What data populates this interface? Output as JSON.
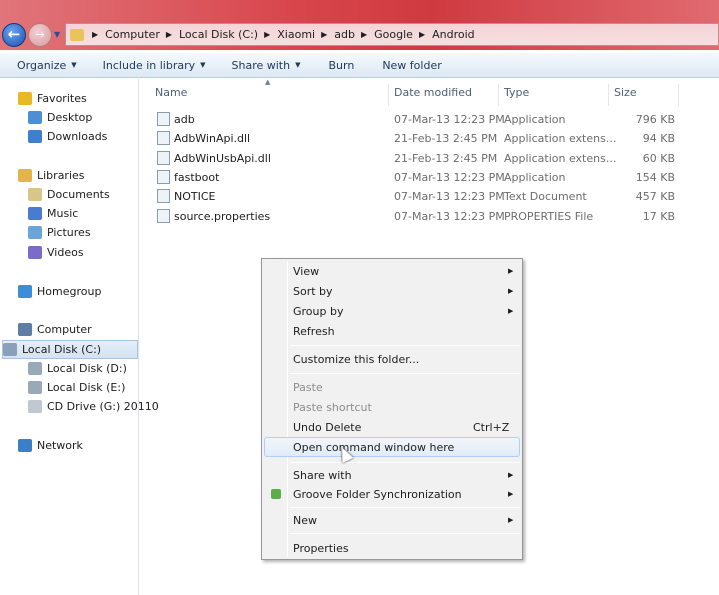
{
  "address": {
    "crumbs": [
      "Computer",
      "Local Disk (C:)",
      "Xiaomi",
      "adb",
      "Google",
      "Android"
    ]
  },
  "toolbar": {
    "organize": "Organize",
    "include": "Include in library",
    "share": "Share with",
    "burn": "Burn",
    "new_folder": "New folder"
  },
  "sidebar": {
    "items": [
      {
        "label": "Favorites",
        "icon": "star-icon"
      },
      {
        "label": "Desktop",
        "icon": "desktop-icon"
      },
      {
        "label": "Downloads",
        "icon": "downloads-icon"
      },
      {
        "label": "Libraries",
        "icon": "libraries-icon"
      },
      {
        "label": "Documents",
        "icon": "documents-icon"
      },
      {
        "label": "Music",
        "icon": "music-icon"
      },
      {
        "label": "Pictures",
        "icon": "pictures-icon"
      },
      {
        "label": "Videos",
        "icon": "videos-icon"
      },
      {
        "label": "Homegroup",
        "icon": "homegroup-icon"
      },
      {
        "label": "Computer",
        "icon": "computer-icon"
      },
      {
        "label": "Local Disk (C:)",
        "icon": "disk-icon"
      },
      {
        "label": "Local Disk (D:)",
        "icon": "disk-icon"
      },
      {
        "label": "Local Disk (E:)",
        "icon": "disk-icon"
      },
      {
        "label": "CD Drive (G:) 20110",
        "icon": "cd-icon"
      },
      {
        "label": "Network",
        "icon": "network-icon"
      }
    ]
  },
  "columns": {
    "name": "Name",
    "date": "Date modified",
    "type": "Type",
    "size": "Size"
  },
  "files": [
    {
      "name": "adb",
      "date": "07-Mar-13 12:23 PM",
      "type": "Application",
      "size": "796 KB"
    },
    {
      "name": "AdbWinApi.dll",
      "date": "21-Feb-13 2:45 PM",
      "type": "Application extens...",
      "size": "94 KB"
    },
    {
      "name": "AdbWinUsbApi.dll",
      "date": "21-Feb-13 2:45 PM",
      "type": "Application extens...",
      "size": "60 KB"
    },
    {
      "name": "fastboot",
      "date": "07-Mar-13 12:23 PM",
      "type": "Application",
      "size": "154 KB"
    },
    {
      "name": "NOTICE",
      "date": "07-Mar-13 12:23 PM",
      "type": "Text Document",
      "size": "457 KB"
    },
    {
      "name": "source.properties",
      "date": "07-Mar-13 12:23 PM",
      "type": "PROPERTIES File",
      "size": "17 KB"
    }
  ],
  "menu": {
    "view": "View",
    "sort": "Sort by",
    "group": "Group by",
    "refresh": "Refresh",
    "customize": "Customize this folder...",
    "paste": "Paste",
    "paste_shortcut": "Paste shortcut",
    "undo": "Undo Delete",
    "undo_shortcut": "Ctrl+Z",
    "open_cmd": "Open command window here",
    "share": "Share with",
    "groove": "Groove Folder Synchronization",
    "new": "New",
    "properties": "Properties"
  }
}
